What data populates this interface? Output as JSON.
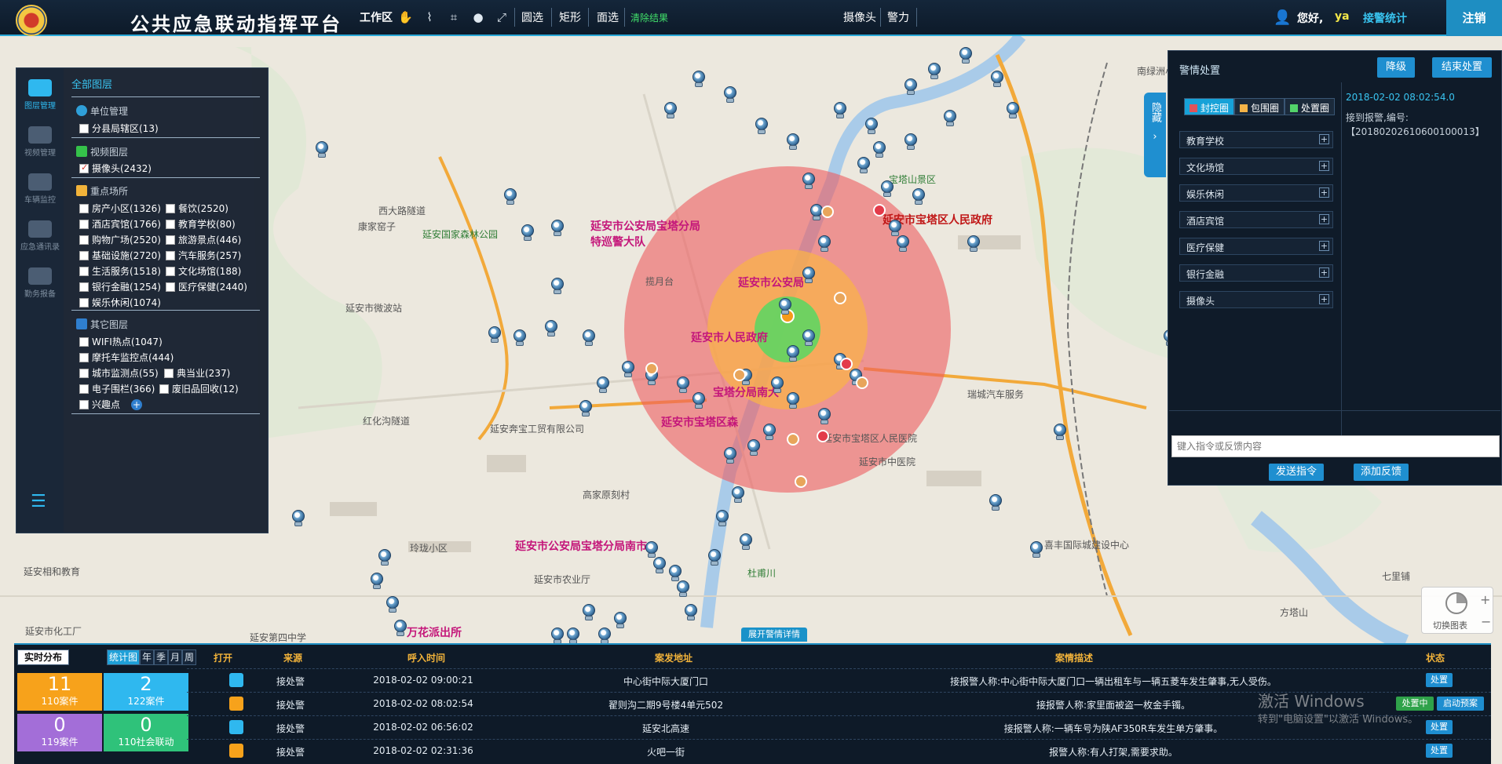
{
  "app": {
    "title": "公共应急联动指挥平台",
    "colors": {
      "accent": "#1f8fd0",
      "header_bg": "#0d1a29",
      "panel_bg": "#0f1b29",
      "green_text": "#41e06a"
    }
  },
  "toolbar": {
    "workspace": "工作区",
    "circle_select": "圆选",
    "rect_select": "矩形",
    "area_select": "面选",
    "clear_results": "清除结果",
    "camera": "摄像头",
    "police": "警力",
    "icons": [
      "hand-icon",
      "ruler-icon",
      "crop-icon",
      "pin-icon",
      "fullscreen-icon"
    ]
  },
  "user": {
    "greeting": "您好,",
    "name": "ya",
    "stats_link": "接警统计",
    "logout": "注销"
  },
  "left_rail": [
    {
      "label": "图层管理",
      "icon": "layers-icon",
      "active": true
    },
    {
      "label": "视频管理",
      "icon": "video-icon",
      "active": false
    },
    {
      "label": "车辆监控",
      "icon": "car-icon",
      "active": false
    },
    {
      "label": "应急通讯录",
      "icon": "contacts-icon",
      "active": false
    },
    {
      "label": "勤务报备",
      "icon": "report-icon",
      "active": false
    }
  ],
  "layers": {
    "title": "全部图层",
    "unit_mgmt": "单位管理",
    "branch_area": "分县局辖区(13)",
    "video_layer": "视频图层",
    "cameras": "摄像头(2432)",
    "key_places": "重点场所",
    "items": [
      [
        "房产小区(1326)",
        "餐饮(2520)"
      ],
      [
        "酒店宾馆(1766)",
        "教育学校(80)"
      ],
      [
        "购物广场(2520)",
        "旅游景点(446)"
      ],
      [
        "基础设施(2720)",
        "汽车服务(257)"
      ],
      [
        "生活服务(1518)",
        "文化场馆(188)"
      ],
      [
        "银行金融(1254)",
        "医疗保健(2440)"
      ],
      [
        "娱乐休闲(1074)"
      ]
    ],
    "other_layers": "其它图层",
    "other_items": [
      [
        "WIFI热点(1047)"
      ],
      [
        "摩托车监控点(444)"
      ],
      [
        "城市监测点(55)",
        "典当业(237)"
      ],
      [
        "电子围栏(366)",
        "废旧品回收(12)"
      ],
      [
        "兴趣点"
      ]
    ]
  },
  "right_panel": {
    "title": "警情处置",
    "downgrade": "降级",
    "end_handling": "结束处置",
    "side_tab": "隐藏",
    "tabs": [
      {
        "label": "封控圈",
        "color": "#e0545a"
      },
      {
        "label": "包围圈",
        "color": "#f4b347"
      },
      {
        "label": "处置圈",
        "color": "#52d36a"
      }
    ],
    "categories": [
      "教育学校",
      "文化场馆",
      "娱乐休闲",
      "酒店宾馆",
      "医疗保健",
      "银行金融",
      "摄像头"
    ],
    "time": "2018-02-02 08:02:54.0",
    "detail": "接到报警,编号:【20180202610600100013】",
    "input_placeholder": "键入指令或反馈内容",
    "send_cmd": "发送指令",
    "add_feedback": "添加反馈"
  },
  "map": {
    "labels": [
      {
        "t": "延安市公安局宝塔分局特巡警大队",
        "cls": "police"
      },
      {
        "t": "延安市宝塔区人民政府",
        "cls": "gov"
      },
      {
        "t": "延安市公安局宝塔分局南市",
        "cls": "police"
      },
      {
        "t": "延安市宝塔区森",
        "cls": "police"
      },
      {
        "t": "延安市人民政府",
        "cls": "police"
      },
      {
        "t": "宝塔分局南大",
        "cls": "police"
      },
      {
        "t": "延安市公安局",
        "cls": "police"
      },
      {
        "t": "万花派出所",
        "cls": "police"
      },
      {
        "t": "西大路隧道",
        "cls": ""
      },
      {
        "t": "延安国家森林公园",
        "cls": "green"
      },
      {
        "t": "宝塔山景区",
        "cls": "green"
      },
      {
        "t": "揽月台",
        "cls": ""
      },
      {
        "t": "红化沟隧道",
        "cls": ""
      },
      {
        "t": "延安奔宝工贸有限公司",
        "cls": ""
      },
      {
        "t": "高家原刻村",
        "cls": ""
      },
      {
        "t": "延安市中医院",
        "cls": ""
      },
      {
        "t": "延安市宝塔区人民医院",
        "cls": ""
      },
      {
        "t": "杜甫川",
        "cls": "green"
      },
      {
        "t": "延安市农业厅",
        "cls": ""
      },
      {
        "t": "瑞城汽车服务",
        "cls": ""
      },
      {
        "t": "喜丰国际城建设中心",
        "cls": ""
      },
      {
        "t": "方塔山",
        "cls": ""
      },
      {
        "t": "七里铺",
        "cls": ""
      },
      {
        "t": "延安相和教育",
        "cls": ""
      },
      {
        "t": "延安市微波站",
        "cls": ""
      },
      {
        "t": "南绿洲小区",
        "cls": ""
      },
      {
        "t": "康家窑子",
        "cls": ""
      },
      {
        "t": "延安市化工厂",
        "cls": ""
      },
      {
        "t": "延安第四中学",
        "cls": ""
      },
      {
        "t": "玲珑小区",
        "cls": ""
      }
    ],
    "camera_icon": "camera-icon",
    "open_detail": "展开警情详情",
    "widget_label": "切换图表"
  },
  "bottom": {
    "tab_realtime": "实时分布",
    "tab_chart": "统计图",
    "periods": [
      "年",
      "季",
      "月",
      "周"
    ],
    "stats": [
      {
        "num": "11",
        "label": "110案件",
        "color": "#f7a21b"
      },
      {
        "num": "2",
        "label": "122案件",
        "color": "#2fb8ef"
      },
      {
        "num": "0",
        "label": "119案件",
        "color": "#a36ed8"
      },
      {
        "num": "0",
        "label": "110社会联动",
        "color": "#2fc27a"
      }
    ],
    "headers": [
      "打开",
      "来源",
      "呼入时间",
      "案发地址",
      "案情描述",
      "状态"
    ],
    "rows": [
      {
        "icon_color": "#2fb8ef",
        "source": "接处警",
        "time": "2018-02-02 09:00:21",
        "address": "中心街中际大厦门口",
        "desc": "接报警人称:中心街中际大厦门口一辆出租车与一辆五菱车发生肇事,无人受伤。",
        "status": [
          "处置"
        ]
      },
      {
        "icon_color": "#f7a21b",
        "source": "接处警",
        "time": "2018-02-02 08:02:54",
        "address": "翟则沟二期9号楼4单元502",
        "desc": "接报警人称:家里面被盗一枚金手镯。",
        "status": [
          "处置中",
          "启动预案"
        ]
      },
      {
        "icon_color": "#2fb8ef",
        "source": "接处警",
        "time": "2018-02-02 06:56:02",
        "address": "延安北高速",
        "desc": "接报警人称:一辆车号为陕AF350R车发生单方肇事。",
        "status": [
          "处置"
        ]
      },
      {
        "icon_color": "#f7a21b",
        "source": "接处警",
        "time": "2018-02-02 02:31:36",
        "address": "火吧一街",
        "desc": "报警人称:有人打架,需要求助。",
        "status": [
          "处置"
        ]
      }
    ],
    "watermark_title": "激活 Windows",
    "watermark_sub": "转到\"电脑设置\"以激活 Windows。"
  }
}
